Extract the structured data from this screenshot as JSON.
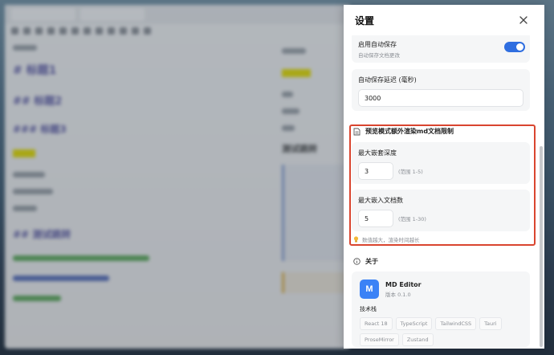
{
  "background": {
    "headings": [
      "# 标题1",
      "## 标题2",
      "### 标题3",
      "## 测试跳转"
    ],
    "right_heading": "测试跳转"
  },
  "drawer": {
    "title": "设置",
    "autosave": {
      "enable_label": "启用自动保存",
      "enable_desc": "自动保存文档更改",
      "enabled": true,
      "delay_label": "自动保存延迟 (毫秒)",
      "delay_value": "3000"
    },
    "preview": {
      "title": "预览模式额外渲染md文档限制",
      "max_depth_label": "最大嵌套深度",
      "max_depth_value": "3",
      "max_depth_range": "(范围 1-5)",
      "max_docs_label": "最大嵌入文档数",
      "max_docs_value": "5",
      "max_docs_range": "(范围 1-30)",
      "hint": "数值越大，渲染时间越长"
    },
    "about": {
      "title": "关于",
      "app_name": "MD Editor",
      "version": "版本 0.1.0",
      "logo_letter": "M",
      "stack_label": "技术栈",
      "stack": [
        "React 18",
        "TypeScript",
        "TailwindCSS",
        "Tauri",
        "ProseMirror",
        "Zustand"
      ]
    }
  },
  "colors": {
    "accent": "#2f6ee0",
    "highlight_border": "#d9452f",
    "logo_bg": "#3b82f6"
  }
}
